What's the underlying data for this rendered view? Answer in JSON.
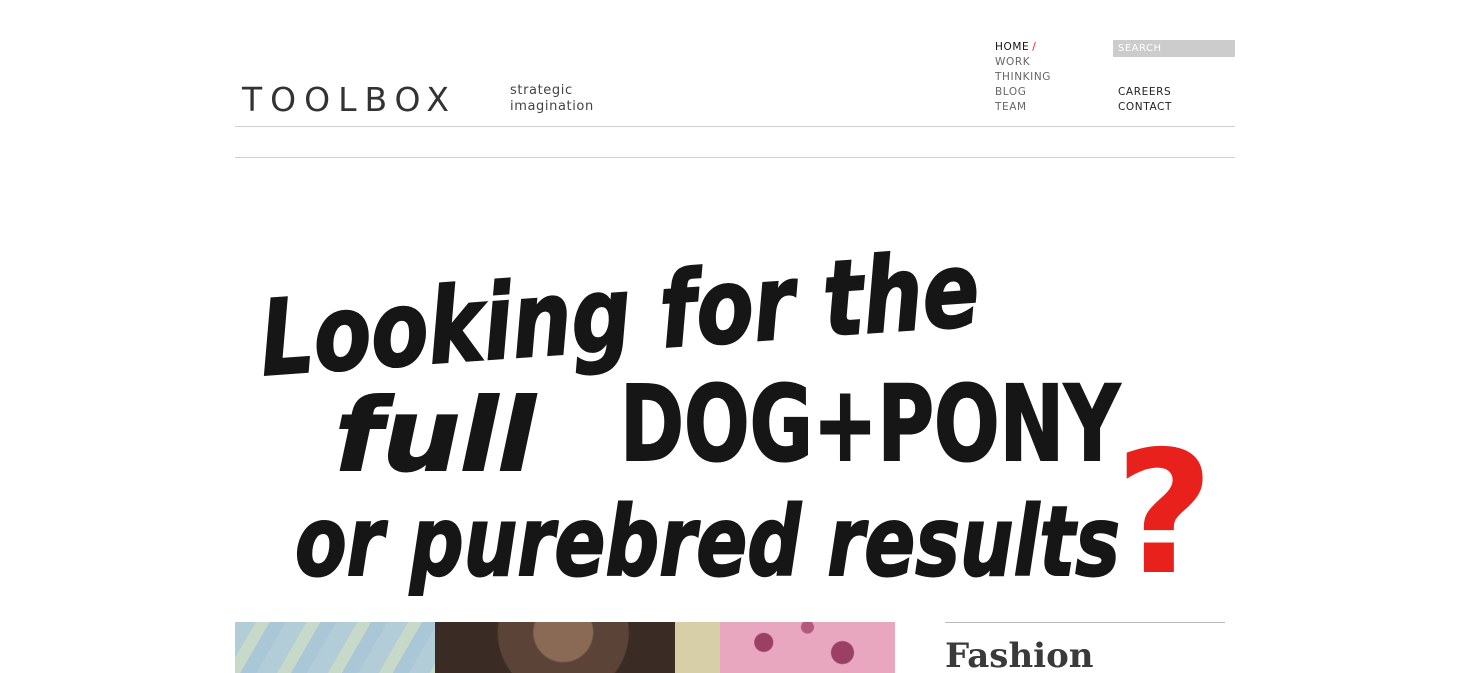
{
  "header": {
    "logo": "TOOLBOX",
    "tagline_line1": "strategic",
    "tagline_line2": "imagination"
  },
  "nav": {
    "primary": [
      {
        "label": "HOME",
        "active": true,
        "marker": "/"
      },
      {
        "label": "WORK"
      },
      {
        "label": "THINKING"
      },
      {
        "label": "BLOG"
      },
      {
        "label": "TEAM"
      }
    ],
    "secondary": [
      {
        "label": "CAREERS"
      },
      {
        "label": "CONTACT"
      }
    ]
  },
  "search": {
    "placeholder": "SEARCH"
  },
  "hero": {
    "line1": "Looking for the",
    "line2_a": "full",
    "line2_b": "DOG+PONY",
    "line3": "or purebred results",
    "question_mark": "?",
    "ink_color": "#161616",
    "accent_color": "#e8211d"
  },
  "feature": {
    "title": "Fashion"
  },
  "colors": {
    "nav_active_slash": "#d9211f",
    "search_bg": "#cccccc",
    "rule": "#cfcfcf"
  }
}
